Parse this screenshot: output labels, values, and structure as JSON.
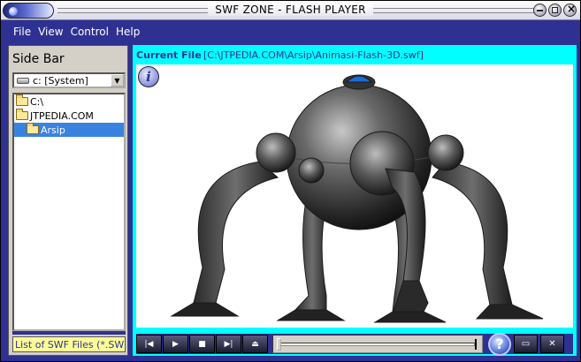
{
  "window": {
    "title": "SWF ZONE - FLASH PLAYER"
  },
  "menu": [
    {
      "label": "File"
    },
    {
      "label": "View"
    },
    {
      "label": "Control"
    },
    {
      "label": "Help"
    }
  ],
  "sidebar": {
    "title": "Side Bar",
    "drive": "c: [System]",
    "folders": [
      {
        "label": "C:\\"
      },
      {
        "label": "JTPEDIA.COM"
      },
      {
        "label": "Arsip"
      }
    ],
    "file_list_label": "List of SWF Files (*.SWF)"
  },
  "main": {
    "current_file_label": "Current File",
    "current_file_path": "[C:\\JTPEDIA.COM\\Arsip\\Animasi-Flash-3D.swf]"
  },
  "controls": {
    "buttons": [
      {
        "icon": "skip-back-icon"
      },
      {
        "icon": "play-icon"
      },
      {
        "icon": "stop-icon"
      },
      {
        "icon": "skip-forward-icon"
      },
      {
        "icon": "eject-icon"
      }
    ],
    "seek_position": 0,
    "help_icon": "help-icon"
  },
  "colors": {
    "frame": "#2e3192",
    "content_bg": "#00ffff",
    "selection": "#3a82e0",
    "file_list_bg": "#ffff99"
  }
}
